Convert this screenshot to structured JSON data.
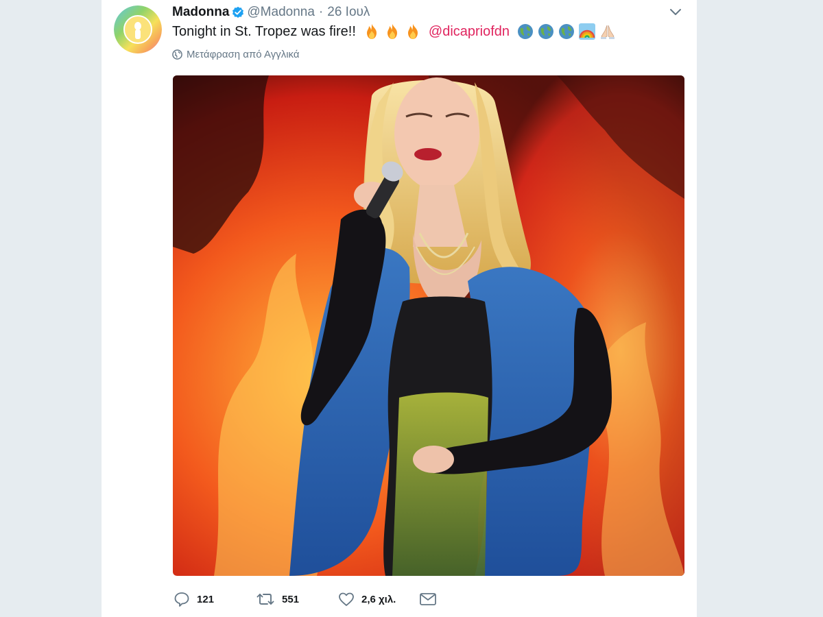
{
  "tweet": {
    "name": "Madonna",
    "handle": "@Madonna",
    "separator": "·",
    "date": "26 Ιουλ",
    "text": "Tonight in St. Tropez was fire!!",
    "mention": "@dicapriofdn",
    "translate_label": "Μετάφραση από Αγγλικά",
    "image_alt": "Madonna performing on stage in front of flames"
  },
  "actions": {
    "reply_count": "121",
    "retweet_count": "551",
    "like_count": "2,6 χιλ."
  },
  "icons": {
    "verified": "verified-badge-icon",
    "caret": "chevron-down-icon",
    "globe": "globe-icon",
    "reply": "reply-icon",
    "retweet": "retweet-icon",
    "like": "heart-icon",
    "dm": "envelope-icon",
    "fire": "fire-emoji",
    "earth": "earth-emoji",
    "rainbow": "rainbow-emoji",
    "pray": "folded-hands-emoji"
  },
  "colors": {
    "background": "#e6ecf0",
    "card": "#ffffff",
    "mention": "#e0245e",
    "verified": "#1da1f2",
    "muted": "#657786"
  }
}
